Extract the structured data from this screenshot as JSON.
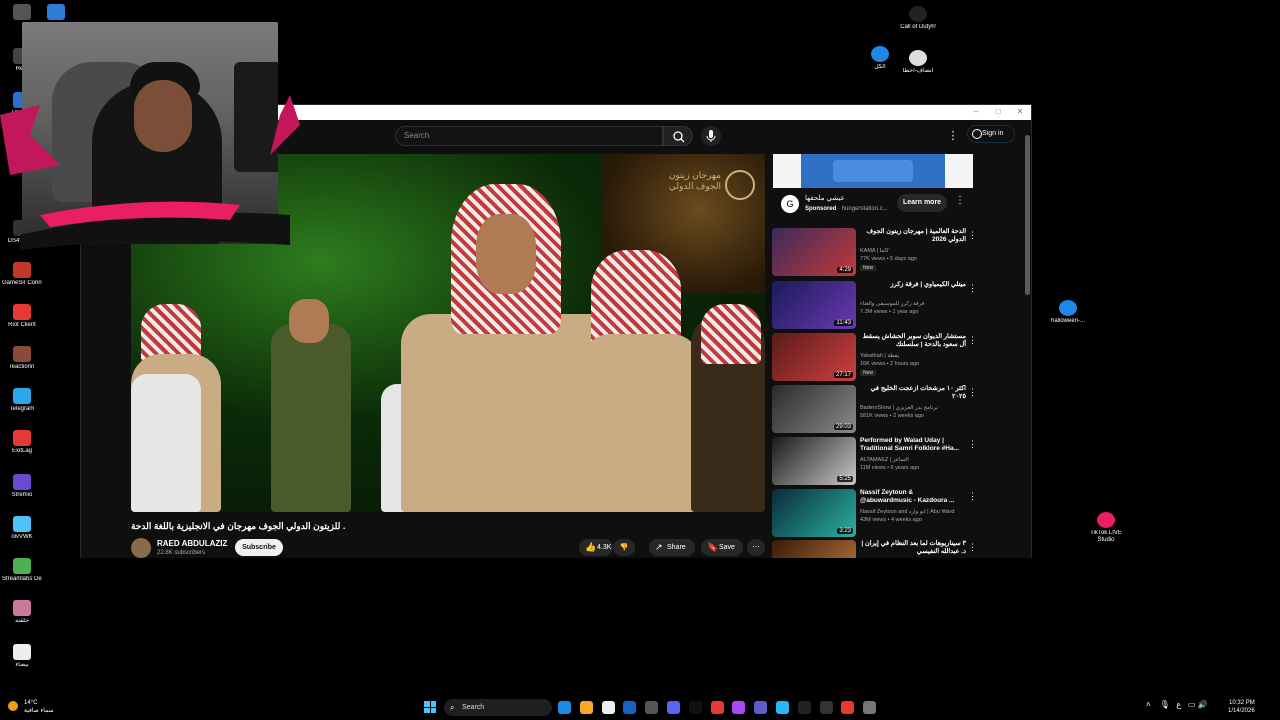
{
  "desktop": {
    "left_icons": [
      {
        "label": "Re...",
        "icon": "app-icon"
      },
      {
        "label": "Ub Con",
        "icon": "ubisoft-icon"
      },
      {
        "label": "Ink",
        "icon": "app-icon"
      },
      {
        "label": "DS4Windo",
        "icon": "controller-icon"
      },
      {
        "label": "GameSir Connect",
        "icon": "gamesir-icon"
      },
      {
        "label": "Riot Client",
        "icon": "riot-icon"
      },
      {
        "label": "reactionn",
        "icon": "folder-image-icon"
      },
      {
        "label": "Telegram",
        "icon": "telegram-icon"
      },
      {
        "label": "ExitLag",
        "icon": "exitlag-icon"
      },
      {
        "label": "Stremio",
        "icon": "stremio-icon"
      },
      {
        "label": "olvVWK",
        "icon": "file-icon"
      },
      {
        "label": "Streamlabs Desktop",
        "icon": "streamlabs-icon"
      },
      {
        "label": "حلقته",
        "icon": "image-file-icon"
      },
      {
        "label": "بيضاء",
        "icon": "blank-file-icon"
      }
    ],
    "right_icons": [
      {
        "label": "Call of Duty®",
        "icon": "cod-icon"
      },
      {
        "label": "الكل",
        "icon": "edge-icon"
      },
      {
        "label": "انضاف-أخطا",
        "icon": "file-icon"
      },
      {
        "label": "halloween-...",
        "icon": "edge-icon"
      },
      {
        "label": "TikTok LIVE Studio",
        "icon": "tiktok-live-icon"
      }
    ]
  },
  "browser": {
    "search_placeholder": "Search",
    "sign_in": "Sign in",
    "video": {
      "title": ". للزيتون الدولي الجوف مهرجان في الانجليزية باللغة الدحة",
      "overlay_logo_text": "مهرجان زيتون الجوف الدولي",
      "channel": "RAED ABDULAZIZ",
      "subscribers": "22.8K subscribers",
      "subscribe": "Subscribe",
      "likes": "4.3K",
      "share": "Share",
      "save": "Save"
    },
    "ad": {
      "title": "عيشي ملحقها",
      "sponsored": "Sponsored",
      "domain": "hungerstation.c...",
      "cta": "Learn more"
    },
    "recommendations": [
      {
        "title": "الدحة العالمية | مهرجان زيتون الجوف الدولي 2026",
        "channel": "KAMA | كاما",
        "meta": "77K views • 5 days ago",
        "duration": "4:29",
        "badge": "New",
        "colors": [
          "#3a2a5a",
          "#c23a3a"
        ]
      },
      {
        "title": "ميتلي الكيمياوي | فرقة زكرز",
        "channel": "فرقة زكرز للموسيقى والغناء",
        "meta": "7.3M views • 1 year ago",
        "duration": "11:43",
        "badge": "",
        "colors": [
          "#1a1a5a",
          "#6a3ab0"
        ]
      },
      {
        "title": "مستشار الديوان سوبر الحشاش يسقط أل سعود بالدحة | سلسلتك",
        "channel": "Yakathah | يقطة",
        "meta": "16K views • 2 hours ago",
        "duration": "27:17",
        "badge": "New",
        "colors": [
          "#5a1a1a",
          "#d04040"
        ]
      },
      {
        "title": "أكثر ١٠ مرشحات ازعجت الخليج في ٢٠٢٥",
        "channel": "BadersShow | برنامج بدر العزيزي",
        "meta": "581K views • 2 weeks ago",
        "duration": "29:03",
        "badge": "",
        "colors": [
          "#2a2a2a",
          "#8a8a8a"
        ]
      },
      {
        "title": "Performed by Walad Uday | Traditional Samri Folklore #Ha...",
        "channel": "ALTAMAEZ | التماعز",
        "meta": "11M views • 6 years ago",
        "duration": "5:25",
        "badge": "",
        "colors": [
          "#1a1a1a",
          "#c8c8c8"
        ]
      },
      {
        "title": "Nassif Zeytoun & @abuwardmusic - Kazdoura ...",
        "channel": "Nassif Zeytoun and أبو وارد | Abu Ward",
        "meta": "43M views • 4 weeks ago",
        "duration": "3:23",
        "badge": "",
        "colors": [
          "#0a2a3a",
          "#2ab0a0"
        ]
      },
      {
        "title": "٣ سيناريوهات لما بعد النظام في إيران | د. عبدالله النفيسي",
        "channel": "",
        "meta": "",
        "duration": "",
        "badge": "",
        "colors": [
          "#3a1a0a",
          "#c07a3a"
        ]
      }
    ]
  },
  "taskbar": {
    "weather_temp": "14°C",
    "weather_desc": "سماء صافية",
    "search": "Search",
    "time": "10:32 PM",
    "date": "1/14/2026",
    "tray_lang": "ع"
  }
}
